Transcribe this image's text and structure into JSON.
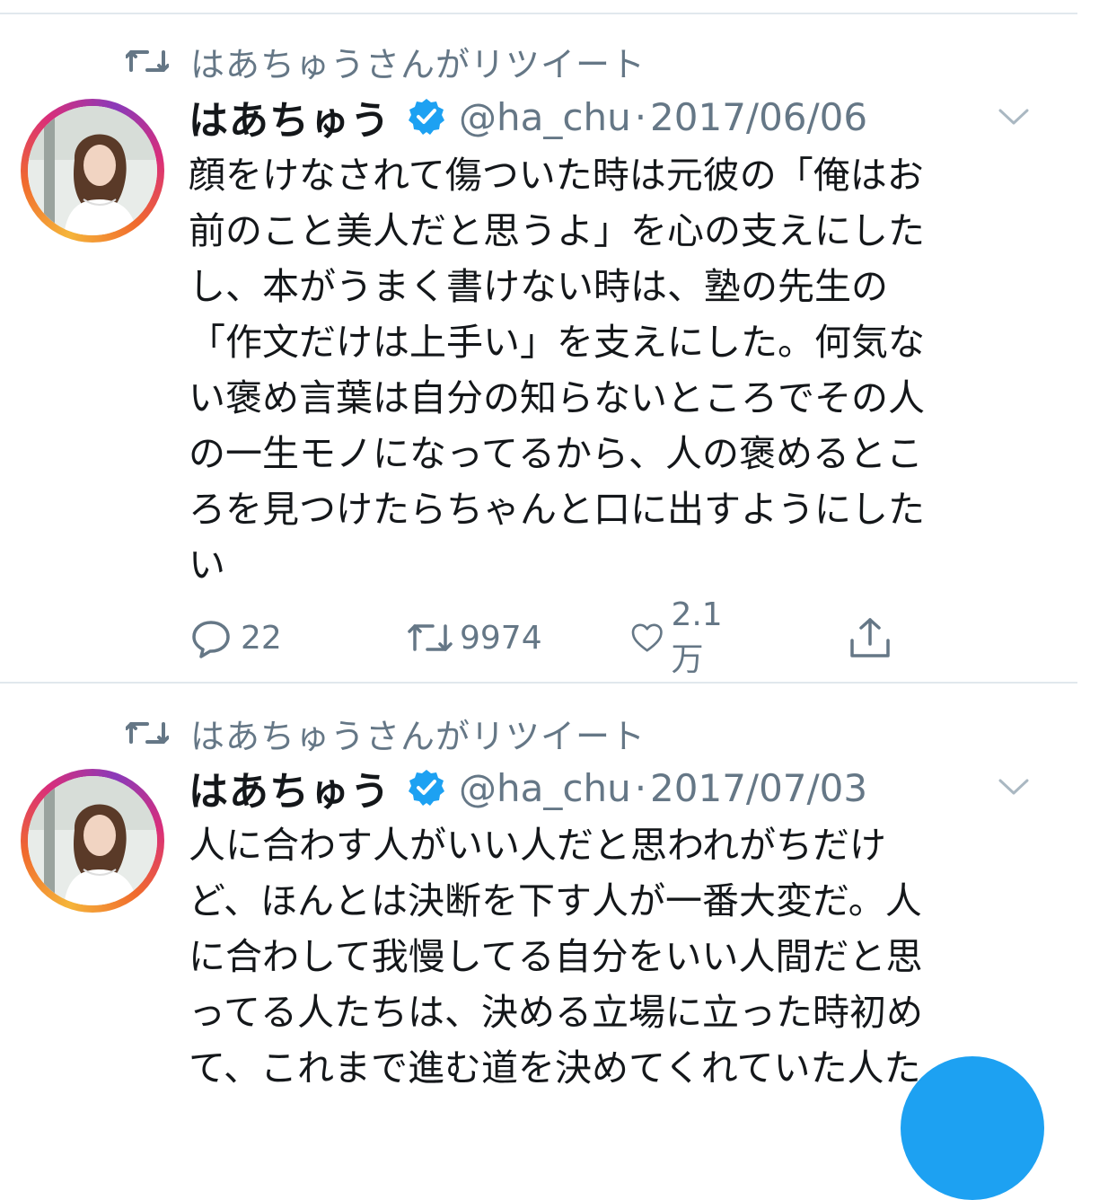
{
  "tweets": [
    {
      "retweeted_by": "はあちゅうさんがリツイート",
      "display_name": "はあちゅう",
      "handle": "@ha_chu",
      "separator": "·",
      "date": "2017/06/06",
      "text": "顔をけなされて傷ついた時は元彼の「俺はお\n前のこと美人だと思うよ」を心の支えにした\nし、本がうまく書けない時は、塾の先生の\n「作文だけは上手い」を支えにした。何気な\nい褒め言葉は自分の知らないところでその人\nの一生モノになってるから、人の褒めるとこ\nろを見つけたらちゃんと口に出すようにした\nい",
      "reply_count": "22",
      "retweet_count": "9974",
      "like_count": "2.1万"
    },
    {
      "retweeted_by": "はあちゅうさんがリツイート",
      "display_name": "はあちゅう",
      "handle": "@ha_chu",
      "separator": "·",
      "date": "2017/07/03",
      "text": "人に合わす人がいい人だと思われがちだけ\nど、ほんとは決断を下す人が一番大変だ。人\nに合わして我慢してる自分をいい人間だと思\nってる人たちは、決める立場に立った時初め\nて、これまで進む道を決めてくれていた人た"
    }
  ],
  "icons": {
    "retweet_indicator": "retweet-icon",
    "verified": "verified-badge-icon",
    "menu": "chevron-down-icon",
    "reply": "reply-icon",
    "retweet": "retweet-icon",
    "like": "heart-icon",
    "share": "share-icon",
    "compose": "compose-fab"
  },
  "colors": {
    "accent": "#1da1f2",
    "secondary_text": "#657786",
    "primary_text": "#14171a",
    "divider": "#e1e8ed"
  }
}
